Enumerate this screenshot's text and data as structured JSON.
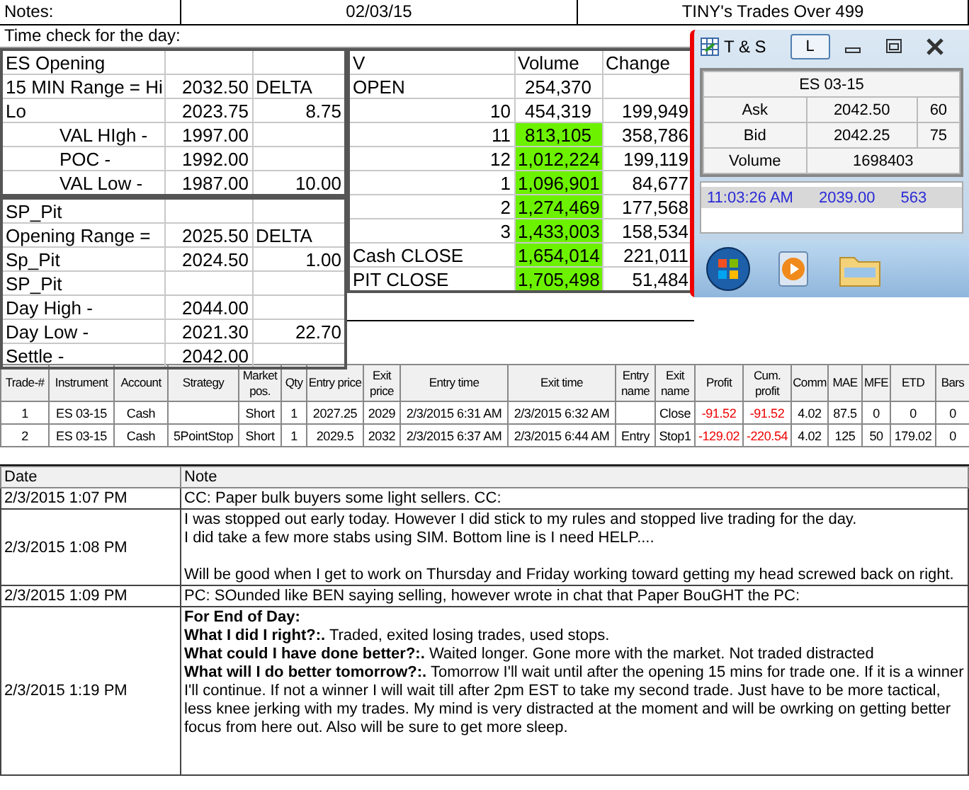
{
  "header": {
    "notes_label": "Notes:",
    "date": "02/03/15",
    "title": "TINY's Trades Over 499"
  },
  "time_check": "Time check for the day:",
  "es_table": [
    {
      "label": "ES Opening",
      "kind": "plain"
    },
    {
      "label": "15 MIN Range = Hi",
      "value": "2032.50",
      "delta": "DELTA",
      "kind": "plain"
    },
    {
      "label": "Lo",
      "value": "2023.75",
      "delta": "8.75",
      "kind": "plain"
    },
    {
      "label": "VAL HIgh   -",
      "value": "1997.00",
      "kind": "indented"
    },
    {
      "label": "POC   -",
      "value": "1992.00",
      "kind": "indented"
    },
    {
      "label": "VAL Low   -",
      "value": "1987.00",
      "delta": "10.00",
      "kind": "indented"
    }
  ],
  "sp_table": [
    {
      "label": "SP_Pit",
      "kind": "plain"
    },
    {
      "label": "Opening Range =",
      "value": "2025.50",
      "delta": "DELTA",
      "kind": "plain"
    },
    {
      "label": "Sp_Pit",
      "value": "2024.50",
      "delta": "1.00",
      "kind": "plain"
    },
    {
      "label": "SP_Pit",
      "kind": "plain"
    },
    {
      "label": "Day High -",
      "value": "2044.00",
      "kind": "plain"
    },
    {
      "label": "Day Low -",
      "value": "2021.30",
      "delta": "22.70",
      "kind": "plain"
    },
    {
      "label": "Settle -",
      "value": "2042.00",
      "kind": "plain"
    }
  ],
  "volume_table": {
    "columns": [
      "V",
      "Volume",
      "Change"
    ],
    "rows": [
      {
        "label": "OPEN",
        "volume": "254,370",
        "highlighted": false
      },
      {
        "label": "10",
        "volume": "454,319",
        "change": "199,949",
        "highlighted": false
      },
      {
        "label": "11",
        "volume": "813,105",
        "change": "358,786",
        "highlighted": true
      },
      {
        "label": "12",
        "volume": "1,012,224",
        "change": "199,119",
        "highlighted": true
      },
      {
        "label": "1",
        "volume": "1,096,901",
        "change": "84,677",
        "highlighted": true
      },
      {
        "label": "2",
        "volume": "1,274,469",
        "change": "177,568",
        "highlighted": true
      },
      {
        "label": "3",
        "volume": "1,433,003",
        "change": "158,534",
        "highlighted": true
      },
      {
        "label": "Cash CLOSE",
        "volume": "1,654,014",
        "change": "221,011",
        "highlighted": true
      },
      {
        "label": "PIT CLOSE",
        "volume": "1,705,498",
        "change": "51,484",
        "highlighted": true
      }
    ]
  },
  "ts_window": {
    "title": "T & S",
    "link_button": "L",
    "symbol": "ES 03-15",
    "quotes": [
      {
        "label": "Ask",
        "price": "2042.50",
        "size": "60"
      },
      {
        "label": "Bid",
        "price": "2042.25",
        "size": "75"
      }
    ],
    "volume_label": "Volume",
    "volume": "1698403",
    "trades": [
      {
        "time": "11:03:26 AM",
        "price": "2039.00",
        "size": "563"
      }
    ]
  },
  "trades": {
    "columns": [
      "Trade-#",
      "Instrument",
      "Account",
      "Strategy",
      "Market pos.",
      "Qty",
      "Entry price",
      "Exit price",
      "Entry time",
      "Exit time",
      "Entry name",
      "Exit name",
      "Profit",
      "Cum. profit",
      "Comm",
      "MAE",
      "MFE",
      "ETD",
      "Bars"
    ],
    "rows": [
      {
        "cells": [
          "1",
          "ES 03-15",
          "Cash",
          "",
          "Short",
          "1",
          "2027.25",
          "2029",
          "2/3/2015 6:31 AM",
          "2/3/2015 6:32 AM",
          "",
          "Close",
          "-91.52",
          "-91.52",
          "4.02",
          "87.5",
          "0",
          "0",
          "0"
        ]
      },
      {
        "cells": [
          "2",
          "ES 03-15",
          "Cash",
          "5PointStop",
          "Short",
          "1",
          "2029.5",
          "2032",
          "2/3/2015 6:37 AM",
          "2/3/2015 6:44 AM",
          "Entry",
          "Stop1",
          "-129.02",
          "-220.54",
          "4.02",
          "125",
          "50",
          "179.02",
          "0"
        ]
      }
    ]
  },
  "notes": {
    "columns": [
      "Date",
      "Note"
    ],
    "rows": [
      {
        "date": "2/3/2015 1:07 PM",
        "paragraphs": [
          [
            "CC: Paper bulk buyers some light sellers. CC:"
          ]
        ]
      },
      {
        "date": "2/3/2015 1:08 PM",
        "paragraphs": [
          [
            "I was stopped out early today.  However I did stick to my rules and stopped live trading for the day.",
            "I did take a few more stabs using SIM.  Bottom line is I need HELP...."
          ],
          [
            "Will be good when I get to work on Thursday and Friday working toward getting my head screwed back on right."
          ]
        ]
      },
      {
        "date": "2/3/2015 1:09 PM",
        "paragraphs": [
          [
            "PC: SOunded like BEN saying selling, however wrote in chat that Paper BouGHT the PC:"
          ]
        ]
      },
      {
        "date": "2/3/2015 1:19 PM",
        "paragraphs": [
          [
            "**For End of Day:**",
            "**What I did I right?:.**  Traded, exited losing trades, used stops.",
            "**What could I have done better?:.**  Waited longer. Gone more with the market.  Not traded distracted",
            "**What will I do better tomorrow?:.**  Tomorrow I'll wait until after the opening 15 mins for trade one.  If it is a winner I'll continue.  If not a winner I will wait till after 2pm EST to take my second trade.  Just have to be more tactical, less knee jerking with my trades.  My mind is very distracted at the moment and will be owrking on getting better focus from here out.  Also will be sure to get more sleep."
          ]
        ]
      }
    ]
  }
}
